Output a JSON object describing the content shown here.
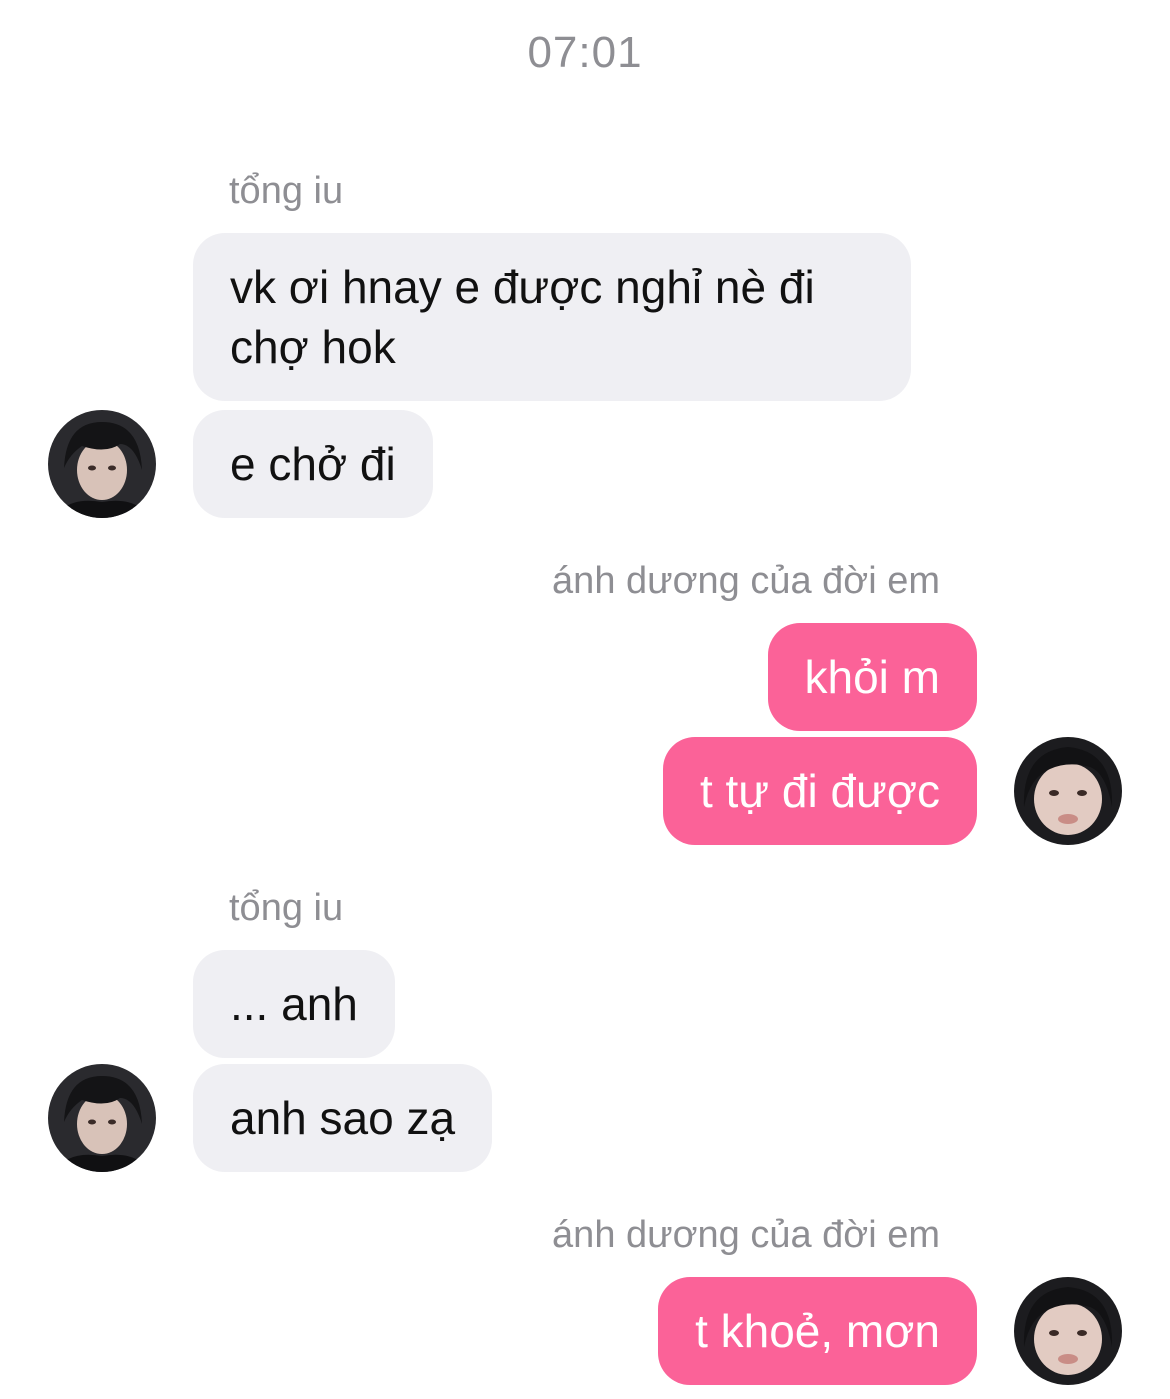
{
  "chat": {
    "timestamp": "07:01",
    "groups": [
      {
        "sender": "tổng iu",
        "messages": [
          "vk ơi hnay e được nghỉ nè đi chợ hok",
          "e chở đi"
        ]
      },
      {
        "sender": "ánh dương của đời em",
        "messages": [
          "khỏi m",
          "t tự đi được"
        ]
      },
      {
        "sender": "tổng iu",
        "messages": [
          "... anh",
          "anh sao zạ"
        ]
      },
      {
        "sender": "ánh dương của đời em",
        "messages": [
          "t khoẻ, mơn"
        ]
      }
    ]
  },
  "colors": {
    "incoming_bubble": "#efeff3",
    "outgoing_bubble": "#fb6298",
    "meta_text": "#8e8e93"
  }
}
